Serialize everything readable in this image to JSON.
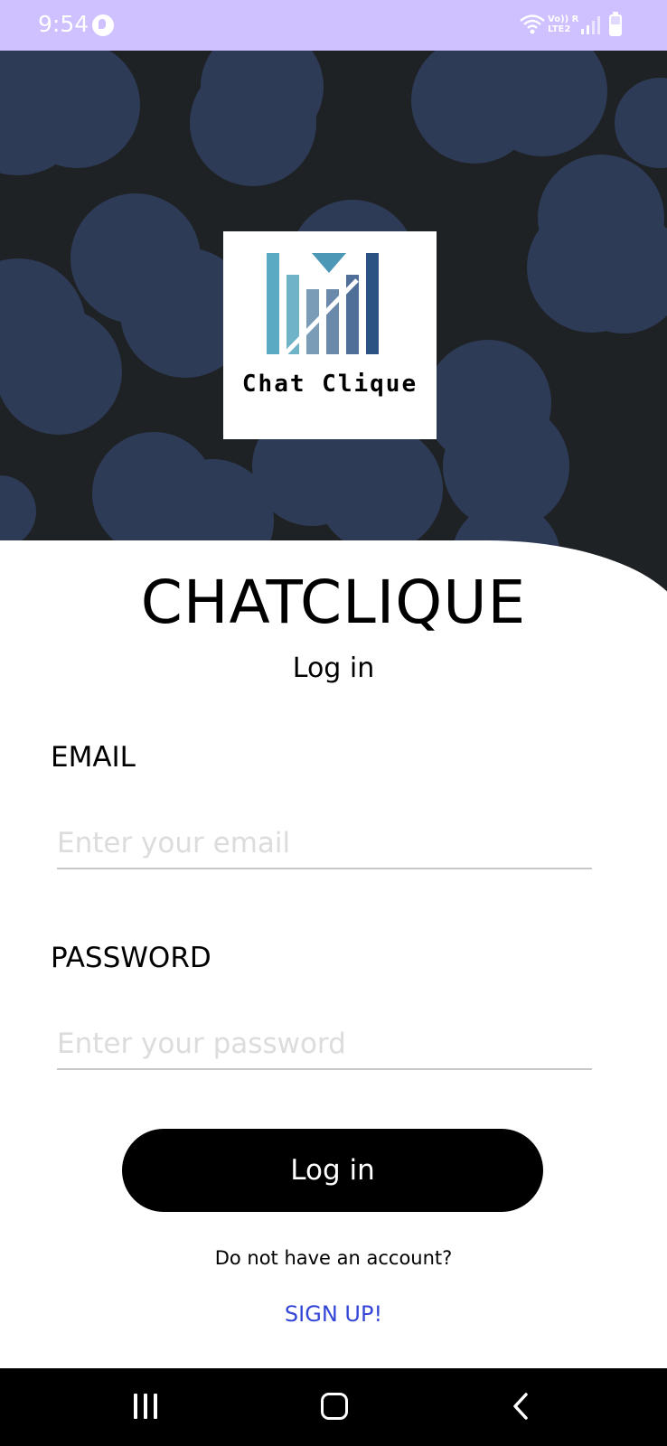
{
  "status_bar": {
    "time": "9:54",
    "network_text_line1": "Vo)) R",
    "network_text_line2": "LTE2",
    "icons": [
      "app-notification-icon",
      "wifi-icon",
      "signal-icon",
      "battery-icon"
    ]
  },
  "logo": {
    "text": "Chat Clique"
  },
  "screen": {
    "app_title": "CHATCLIQUE",
    "subtitle": "Log in"
  },
  "form": {
    "email_label": "EMAIL",
    "email_placeholder": "Enter your email",
    "email_value": "",
    "password_label": "PASSWORD",
    "password_placeholder": "Enter your password",
    "password_value": "",
    "login_button_label": "Log in",
    "no_account_text": "Do not have an account?",
    "signup_link_label": "SIGN UP!"
  },
  "colors": {
    "status_bar_bg": "#cfc0ff",
    "hero_bg": "#1f2225",
    "hero_circle": "#2e3b57",
    "primary_button": "#000000",
    "link": "#3446d6"
  },
  "nav_bar": {
    "icons": [
      "recent-apps-icon",
      "home-icon",
      "back-icon"
    ]
  }
}
